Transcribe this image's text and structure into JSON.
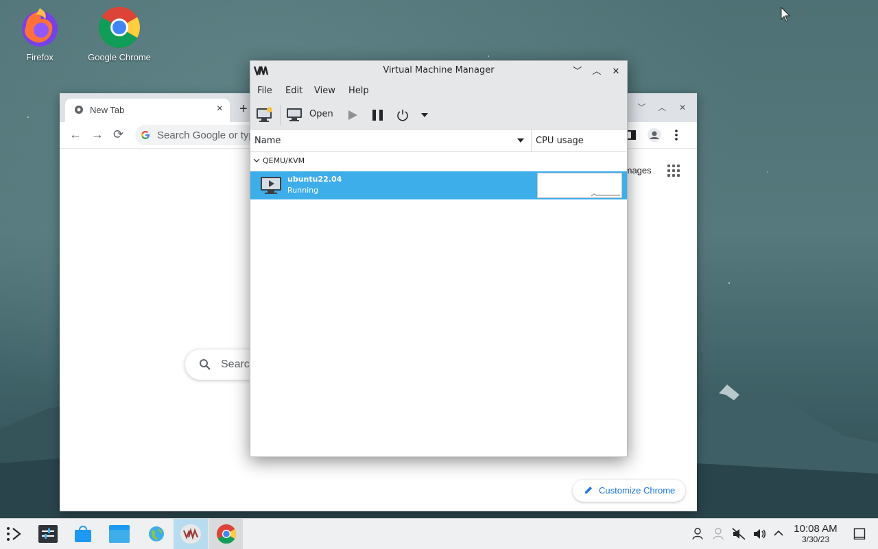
{
  "desktop": {
    "icons": [
      {
        "label": "Firefox"
      },
      {
        "label": "Google Chrome"
      }
    ]
  },
  "chrome": {
    "tab_title": "New Tab",
    "omnibox_placeholder": "Search Google or type a URL",
    "images_link": "Images",
    "search_placeholder": "Search Google or type a URL",
    "customize_label": "Customize Chrome"
  },
  "vmm": {
    "title": "Virtual Machine Manager",
    "menu": [
      "File",
      "Edit",
      "View",
      "Help"
    ],
    "toolbar": {
      "open_label": "Open"
    },
    "columns": {
      "name": "Name",
      "cpu": "CPU usage"
    },
    "group": "QEMU/KVM",
    "vms": [
      {
        "name": "ubuntu22.04",
        "status": "Running"
      }
    ]
  },
  "taskbar": {
    "time": "10:08 AM",
    "date": "3/30/23"
  },
  "colors": {
    "selection": "#3daee9",
    "taskbar": "#eff0f1",
    "chrome_blue": "#1a73e8"
  }
}
